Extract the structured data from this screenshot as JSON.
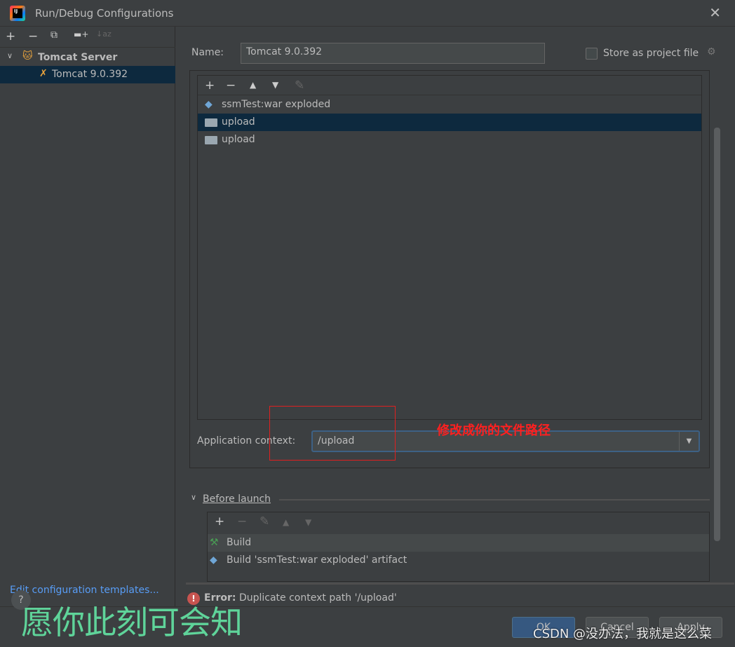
{
  "window": {
    "title": "Run/Debug Configurations",
    "logo_text": "IJ"
  },
  "left": {
    "toolbar": [
      "+",
      "−",
      "⧉",
      "▬+",
      "↓az"
    ],
    "tree": [
      {
        "label": "Tomcat Server",
        "expanded": true
      },
      {
        "label": "Tomcat 9.0.392",
        "selected": true
      }
    ],
    "templates_link": "Edit configuration templates..."
  },
  "form": {
    "name_label": "Name:",
    "name_value": "Tomcat 9.0.392",
    "store_label": "Store as project file",
    "store_checked": false
  },
  "deployment": {
    "toolbar": [
      "+",
      "−",
      "▲",
      "▼",
      "✎"
    ],
    "items": [
      {
        "label": "ssmTest:war exploded",
        "icon": "artifact-icon"
      },
      {
        "label": "upload",
        "icon": "folder-icon",
        "selected": true
      },
      {
        "label": "upload",
        "icon": "folder-icon"
      }
    ],
    "context_label": "Application context:",
    "context_value": "/upload"
  },
  "annotation": "修改成你的文件路径",
  "before_launch": {
    "title": "Before launch",
    "toolbar": [
      "+",
      "−",
      "✎",
      "▲",
      "▼"
    ],
    "items": [
      {
        "label": "Build",
        "icon": "hammer-icon"
      },
      {
        "label": "Build 'ssmTest:war exploded' artifact",
        "icon": "artifact-icon"
      }
    ]
  },
  "error": {
    "prefix": "Error:",
    "message": "Duplicate context path '/upload'"
  },
  "buttons": {
    "ok": "OK",
    "cancel": "Cancel",
    "apply": "Apply",
    "help": "?"
  },
  "overlay": {
    "caption": "愿你此刻可会知",
    "watermark": "CSDN @没办法，我就是这么菜"
  },
  "colors": {
    "accent": "#365880",
    "link": "#589df6",
    "error": "#c75450",
    "annotation": "#ff2020",
    "caption": "#5fd49a"
  }
}
